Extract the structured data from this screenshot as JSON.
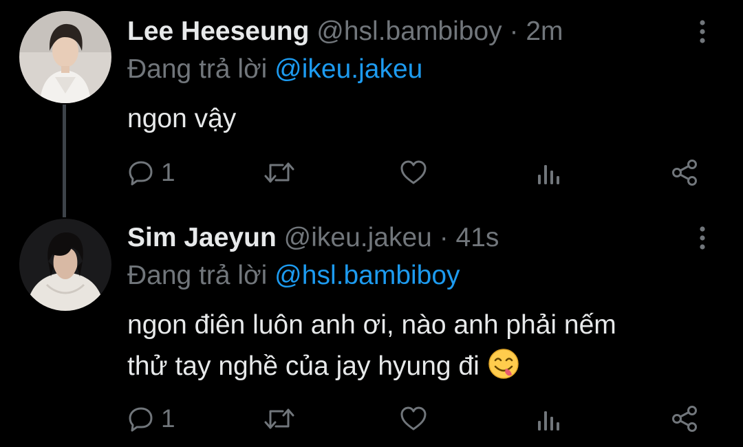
{
  "tweets": [
    {
      "display_name": "Lee Heeseung",
      "handle": "@hsl.bambiboy",
      "separator": "·",
      "time": "2m",
      "reply_prefix": "Đang trả lời",
      "reply_to": "@ikeu.jakeu",
      "text": "ngon vậy",
      "reply_count": "1",
      "avatar_icon": "avatar-photo"
    },
    {
      "display_name": "Sim Jaeyun",
      "handle": "@ikeu.jakeu",
      "separator": "·",
      "time": "41s",
      "reply_prefix": "Đang trả lời",
      "reply_to": "@hsl.bambiboy",
      "text_line1": "ngon điên luôn anh ơi, nào anh phải nếm",
      "text_line2": "thử tay nghề của jay hyung đi",
      "emoji": "face-savoring-food-emoji",
      "reply_count": "1",
      "avatar_icon": "avatar-photo"
    }
  ],
  "icons": {
    "reply": "reply-icon",
    "retweet": "retweet-icon",
    "like": "heart-icon",
    "views": "analytics-icon",
    "share": "share-icon",
    "more": "more-vertical-icon"
  },
  "colors": {
    "background": "#000000",
    "primary_text": "#e7e9ea",
    "secondary_text": "#71767b",
    "link": "#1d9bf0",
    "thread_line": "#3d4349"
  }
}
